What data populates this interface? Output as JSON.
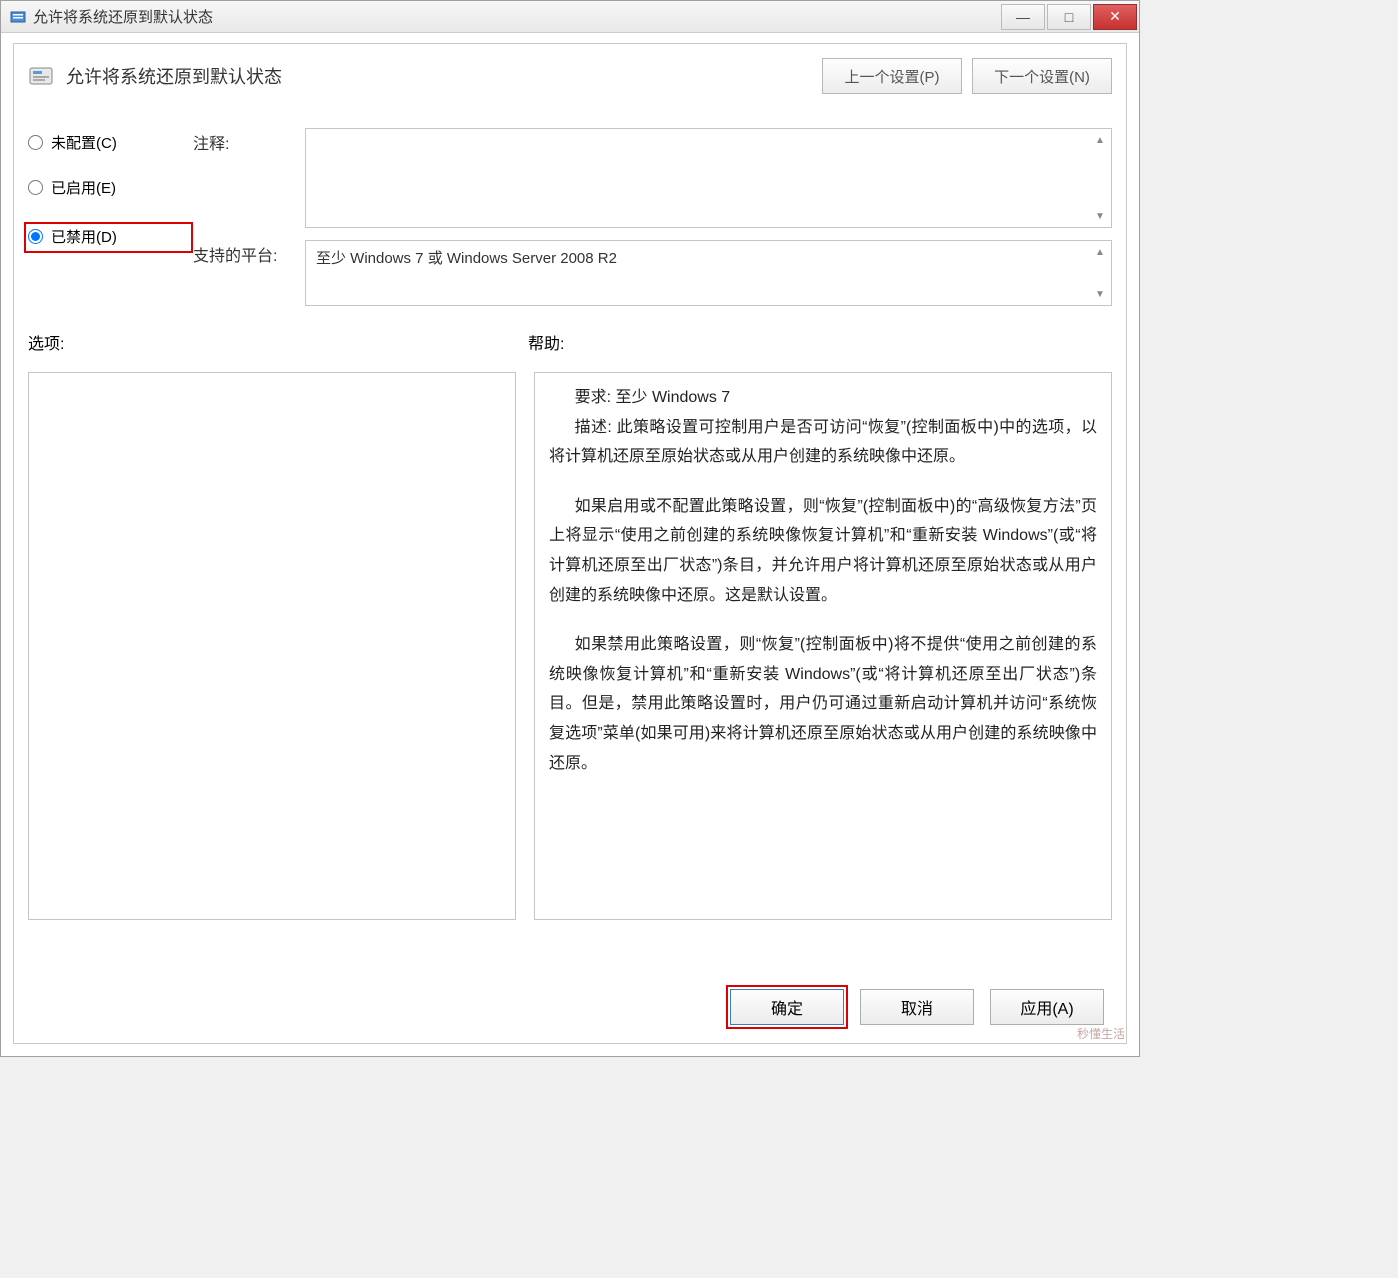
{
  "titlebar": {
    "title": "允许将系统还原到默认状态"
  },
  "header": {
    "policy_title": "允许将系统还原到默认状态",
    "prev_btn": "上一个设置(P)",
    "next_btn": "下一个设置(N)"
  },
  "radios": {
    "not_configured": "未配置(C)",
    "enabled": "已启用(E)",
    "disabled": "已禁用(D)",
    "selected": "disabled"
  },
  "form": {
    "comment_label": "注释:",
    "comment_value": "",
    "supported_label": "支持的平台:",
    "supported_value": "至少 Windows 7 或 Windows Server 2008 R2"
  },
  "section_labels": {
    "options": "选项:",
    "help": "帮助:"
  },
  "help": {
    "req_label": "要求:",
    "req_value": "至少 Windows 7",
    "desc_label": "描述:",
    "p1": "此策略设置可控制用户是否可访问“恢复”(控制面板中)中的选项，以将计算机还原至原始状态或从用户创建的系统映像中还原。",
    "p2": "如果启用或不配置此策略设置，则“恢复”(控制面板中)的“高级恢复方法”页上将显示“使用之前创建的系统映像恢复计算机”和“重新安装 Windows”(或“将计算机还原至出厂状态”)条目，并允许用户将计算机还原至原始状态或从用户创建的系统映像中还原。这是默认设置。",
    "p3": "如果禁用此策略设置，则“恢复”(控制面板中)将不提供“使用之前创建的系统映像恢复计算机”和“重新安装 Windows”(或“将计算机还原至出厂状态”)条目。但是，禁用此策略设置时，用户仍可通过重新启动计算机并访问“系统恢复选项”菜单(如果可用)来将计算机还原至原始状态或从用户创建的系统映像中还原。"
  },
  "footer": {
    "ok": "确定",
    "cancel": "取消",
    "apply": "应用(A)"
  },
  "watermark": "秒懂生活"
}
